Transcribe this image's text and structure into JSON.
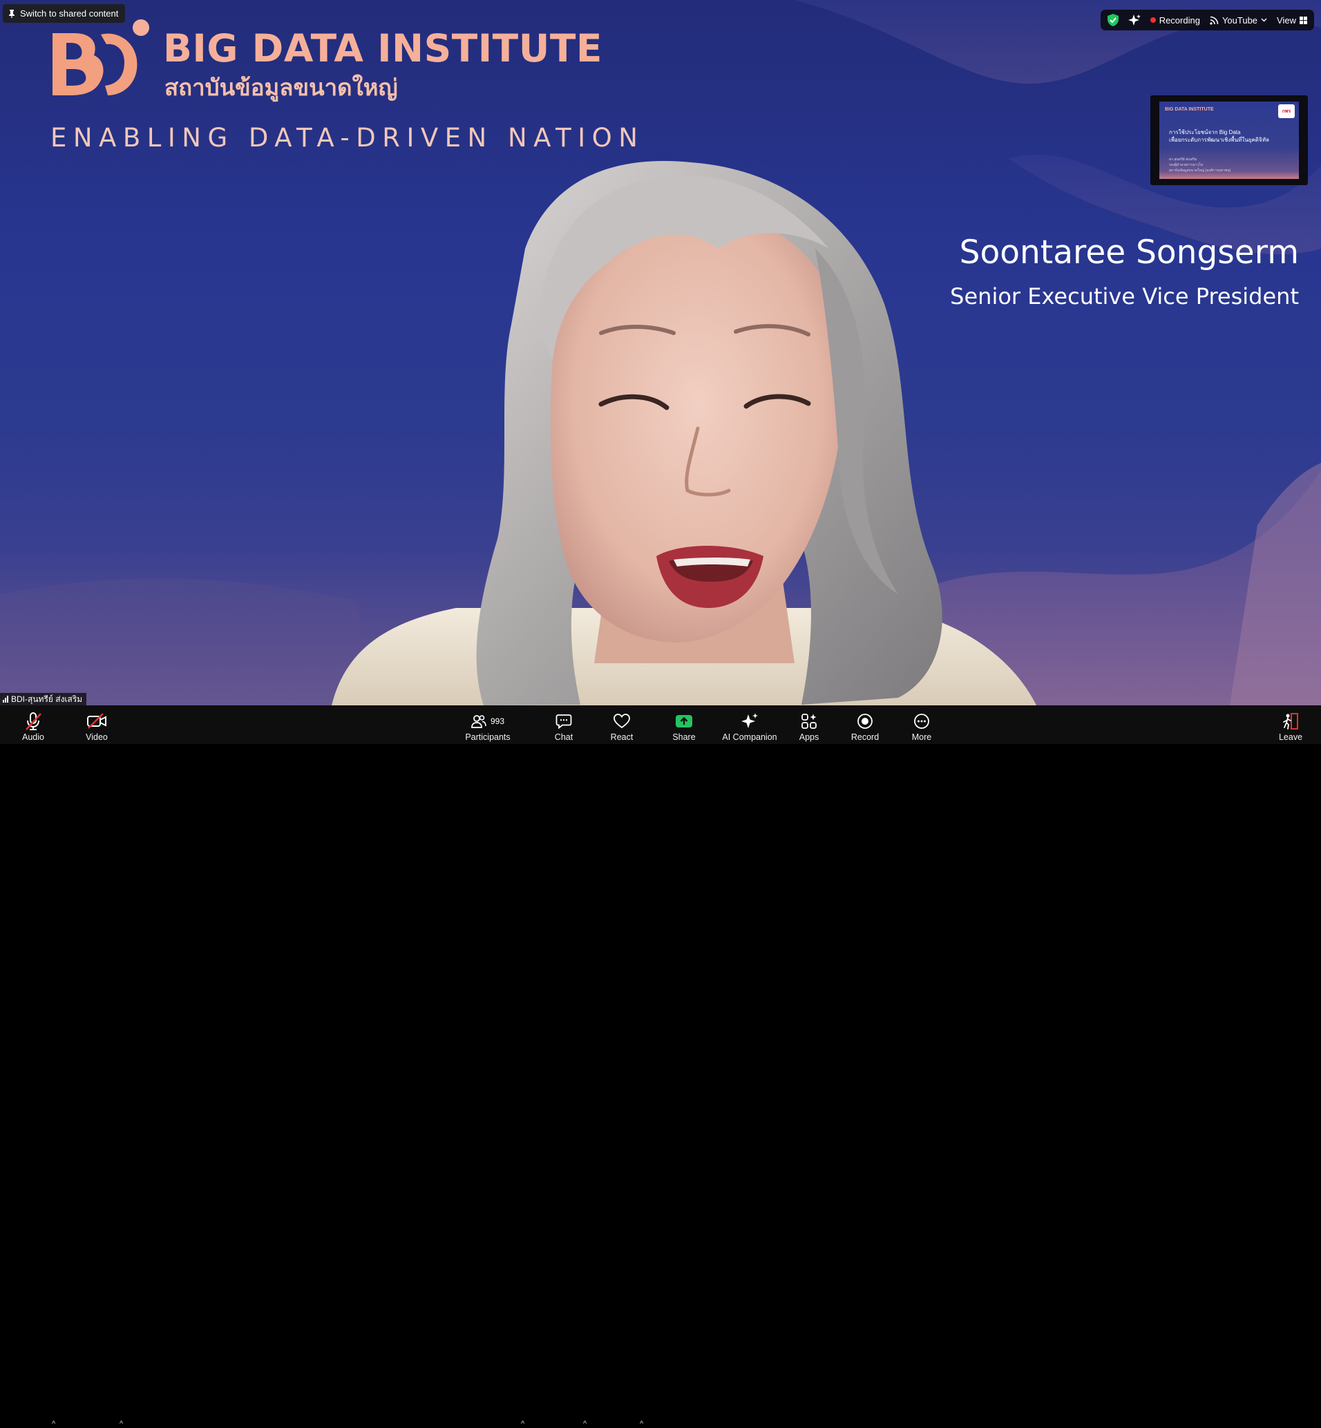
{
  "pin_chip": {
    "label": "Switch to shared content"
  },
  "brand": {
    "logo_text": "BD",
    "title": "BIG DATA INSTITUTE",
    "thai": "สถาบันข้อมูลขนาดใหญ่",
    "tagline": "ENABLING DATA-DRIVEN NATION"
  },
  "speaker": {
    "name": "Soontaree Songserm",
    "role": "Senior Executive Vice President"
  },
  "status_bar": {
    "recording_label": "Recording",
    "stream_label": "YouTube",
    "view_label": "View"
  },
  "slide_thumbnail": {
    "brand": "BIG DATA INSTITUTE",
    "badge": "กพร",
    "title_line1": "การใช้ประโยชน์จาก Big Data",
    "title_line2": "เพื่อยกระดับการพัฒนาเชิงพื้นที่ในยุคดิจิทัล",
    "sub_line1": "ดร.สุนทรีย์ ส่งเสริม",
    "sub_line2": "รองผู้อำนวยการอาวุโส",
    "sub_line3": "สถาบันข้อมูลขนาดใหญ่ (องค์การมหาชน)"
  },
  "participant_label": "BDI-สุนทรีย์ ส่งเสริม",
  "toolbar": {
    "audio": "Audio",
    "video": "Video",
    "participants": "Participants",
    "participant_count": "993",
    "chat": "Chat",
    "react": "React",
    "share": "Share",
    "ai_companion": "AI Companion",
    "apps": "Apps",
    "record": "Record",
    "more": "More",
    "leave": "Leave"
  },
  "colors": {
    "background_top": "#232c7a",
    "background_bottom": "#6a5a90",
    "brand_peach": "#f6b09a",
    "share_green": "#22c55e",
    "record_red": "#ff2d2d",
    "toolbar_bg": "#0e0e0e"
  }
}
